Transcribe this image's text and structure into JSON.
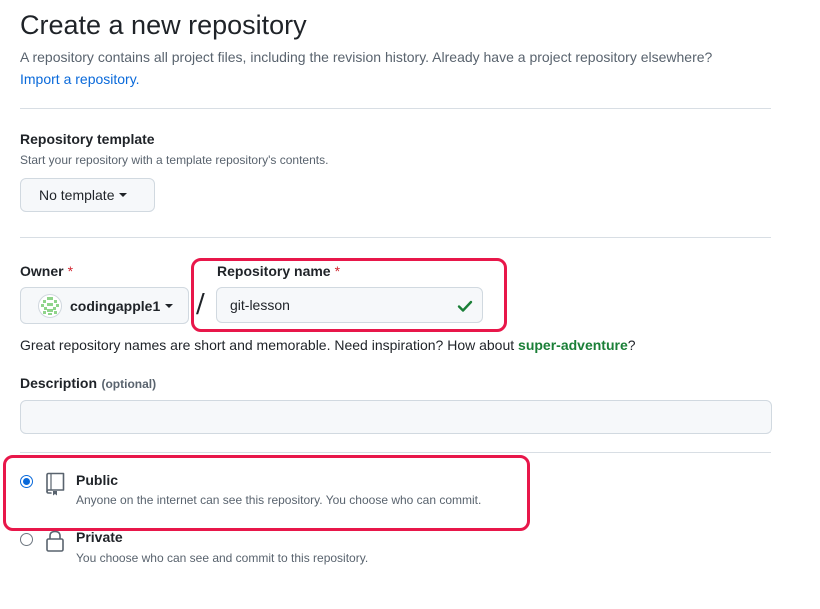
{
  "page": {
    "title": "Create a new repository",
    "intro": "A repository contains all project files, including the revision history. Already have a project repository elsewhere?",
    "import_link": "Import a repository."
  },
  "template": {
    "label": "Repository template",
    "description": "Start your repository with a template repository's contents.",
    "button_label": "No template"
  },
  "owner": {
    "label": "Owner",
    "required_mark": "*",
    "value": "codingapple1",
    "avatar_icon": "identicon-avatar"
  },
  "separator": "/",
  "repo_name": {
    "label": "Repository name",
    "required_mark": "*",
    "value": "git-lesson",
    "valid_icon": "check-icon"
  },
  "name_hint": {
    "text": "Great repository names are short and memorable. Need inspiration? How about ",
    "suggestion": "super-adventure",
    "suffix": "?"
  },
  "description": {
    "label": "Description",
    "optional": "(optional)",
    "value": ""
  },
  "visibility": {
    "public": {
      "title": "Public",
      "description": "Anyone on the internet can see this repository. You choose who can commit.",
      "icon": "repo-icon",
      "checked": true
    },
    "private": {
      "title": "Private",
      "description": "You choose who can see and commit to this repository.",
      "icon": "lock-icon",
      "checked": false
    }
  },
  "colors": {
    "highlight": "#e8174a",
    "link": "#0969da",
    "suggestion": "#1a7f37",
    "check": "#1a7f37"
  }
}
